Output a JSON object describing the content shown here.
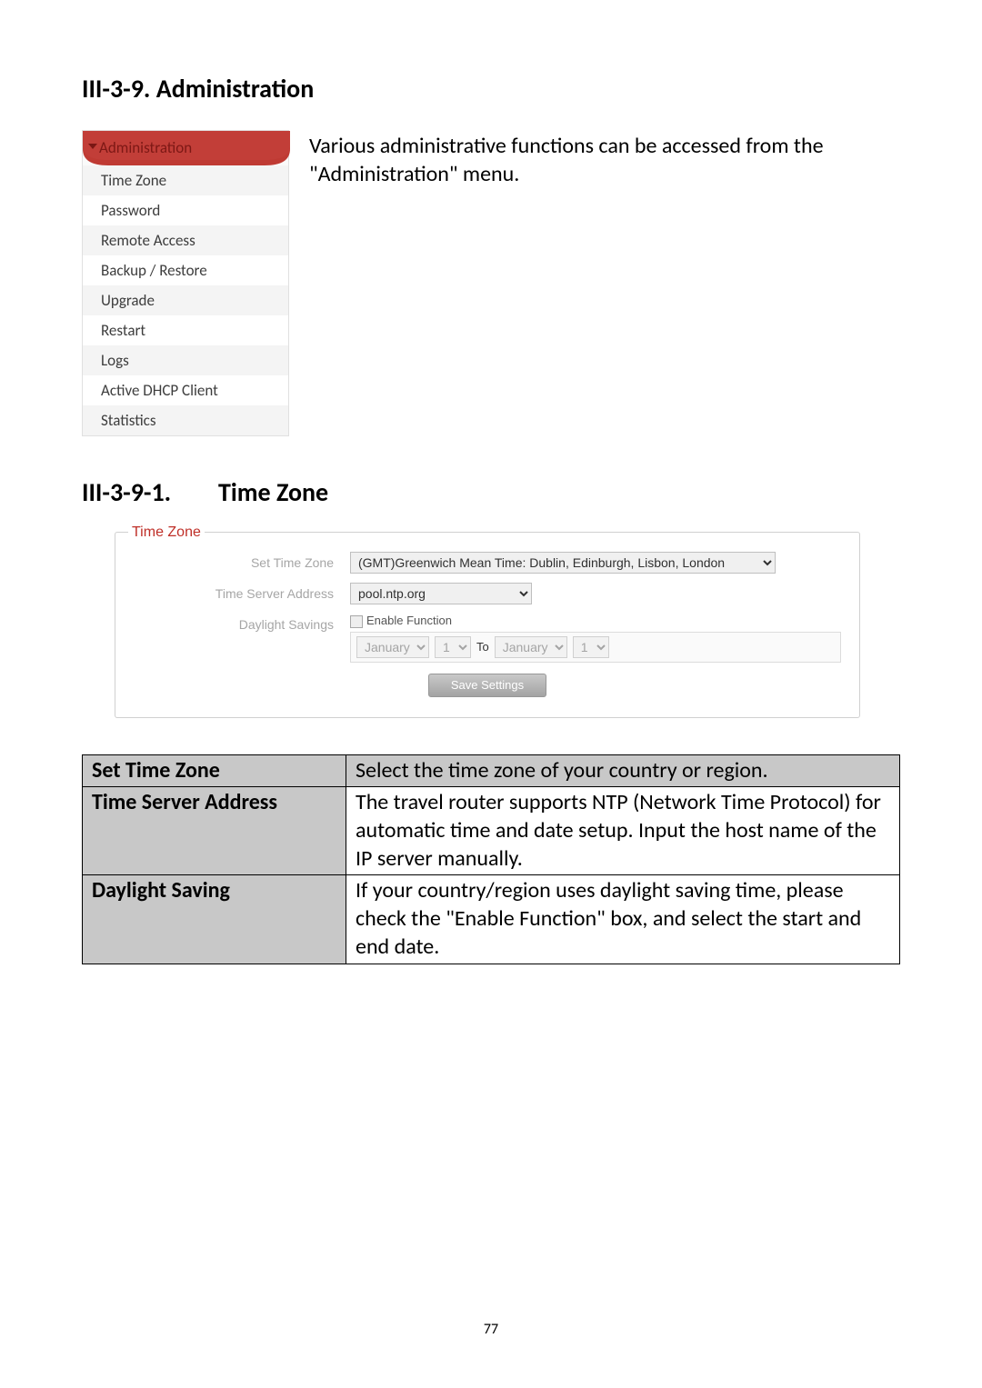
{
  "doc": {
    "section_h1": "III-3-9. Administration",
    "intro": "Various administrative functions can be accessed from the \"Administration\" menu.",
    "nav": {
      "header": "Administration",
      "items": [
        "Time Zone",
        "Password",
        "Remote Access",
        "Backup / Restore",
        "Upgrade",
        "Restart",
        "Logs",
        "Active DHCP Client",
        "Statistics"
      ]
    },
    "section_h2_idx": "III-3-9-1.",
    "section_h2_title": "Time Zone",
    "tz_panel": {
      "legend": "Time Zone",
      "rows": {
        "set_time_zone": {
          "label": "Set Time Zone",
          "value": "(GMT)Greenwich Mean Time: Dublin, Edinburgh, Lisbon, London"
        },
        "time_server": {
          "label": "Time Server Address",
          "value": "pool.ntp.org"
        },
        "daylight": {
          "label": "Daylight Savings",
          "checkbox_label": "Enable Function",
          "from_month": "January",
          "from_day": "1",
          "to_label": "To",
          "to_month": "January",
          "to_day": "1"
        }
      },
      "save_btn": "Save Settings"
    },
    "table": {
      "rows": [
        {
          "key": "Set Time Zone",
          "val": "Select the time zone of your country or region."
        },
        {
          "key": "Time Server Address",
          "val": "The travel router supports NTP (Network Time Protocol) for automatic time and date setup. Input the host name of the IP server manually."
        },
        {
          "key": "Daylight Saving",
          "val": "If your country/region uses daylight saving time, please check the \"Enable Function\" box, and select the start and end date."
        }
      ]
    },
    "page_no": "77"
  }
}
